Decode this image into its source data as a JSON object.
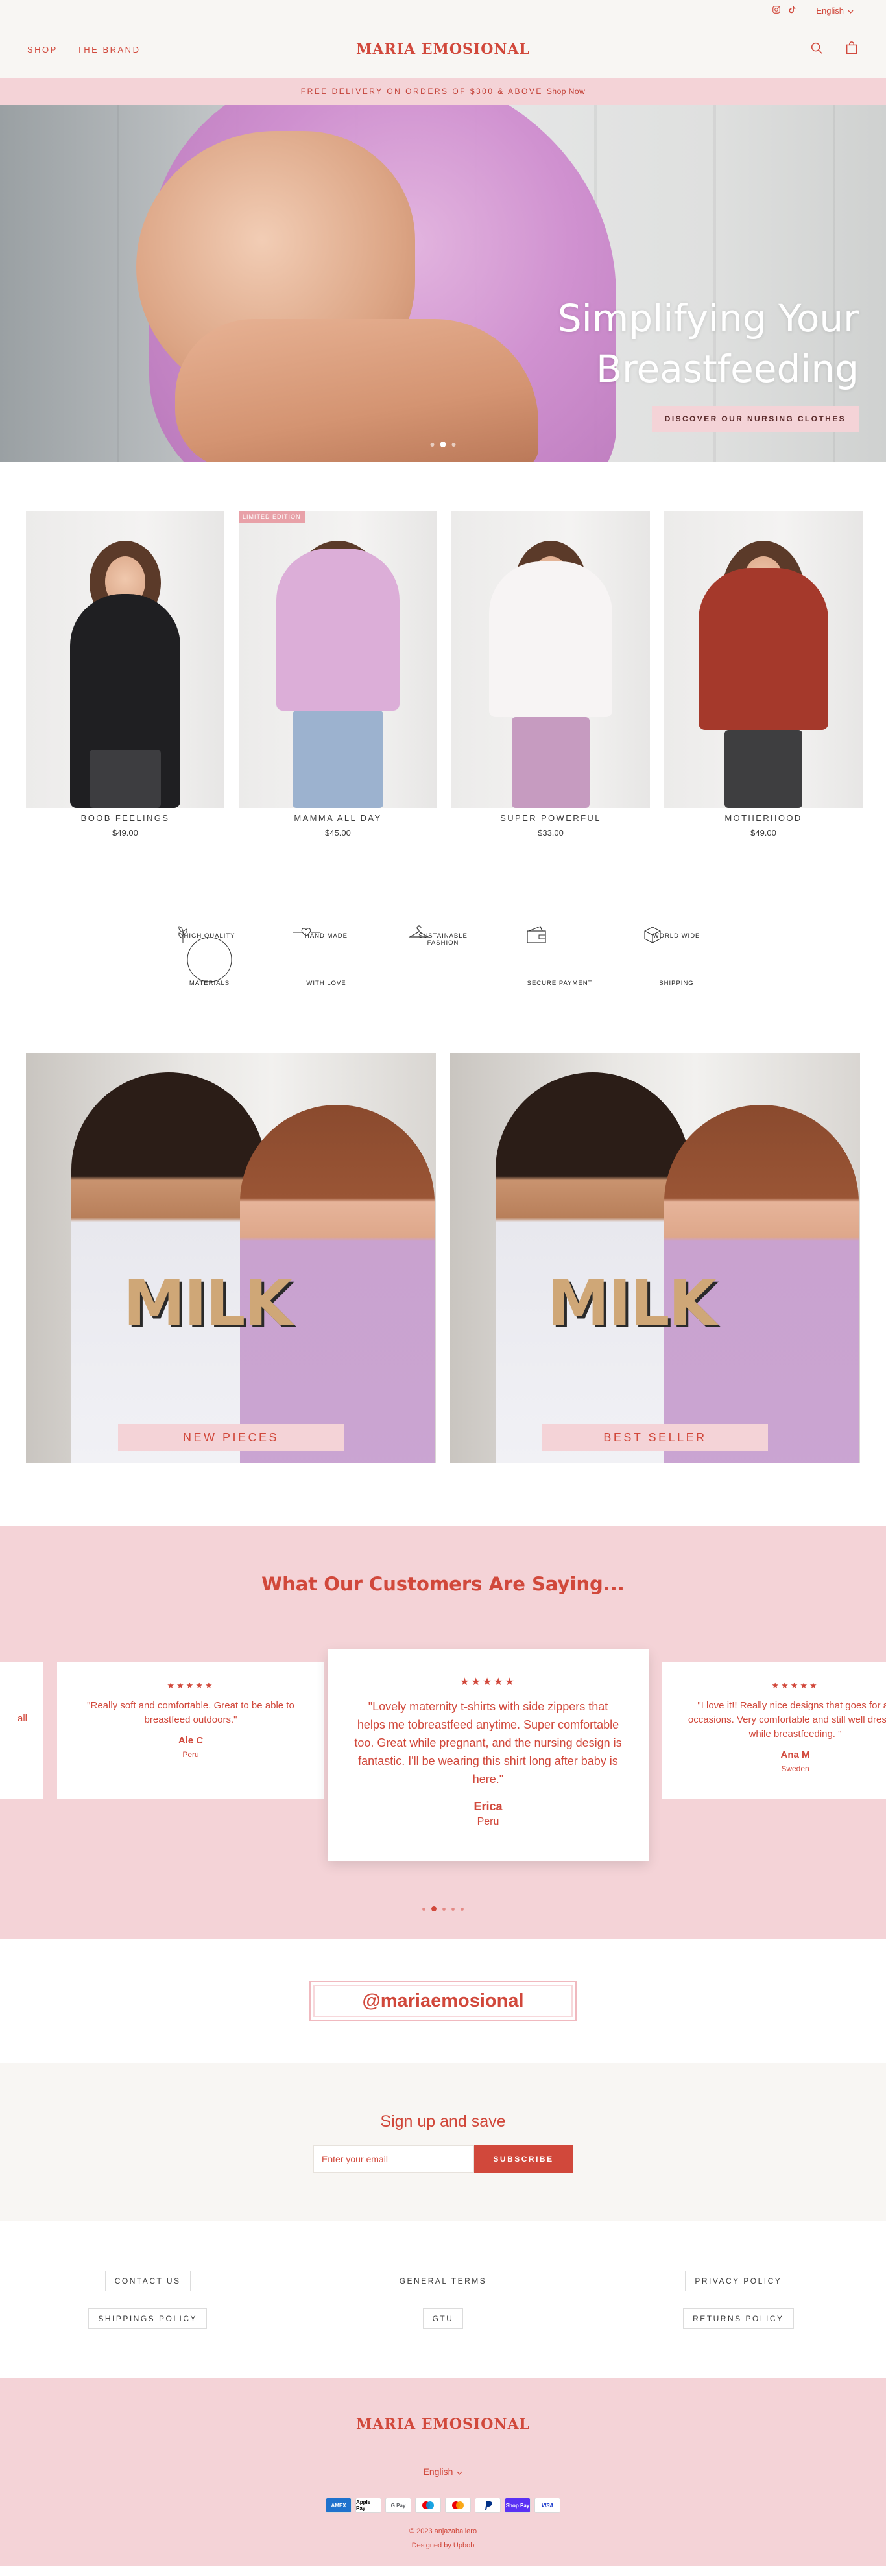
{
  "utility": {
    "language": "English"
  },
  "header": {
    "nav": [
      "SHOP",
      "THE BRAND"
    ],
    "logo": "MARIA EMOSIONAL"
  },
  "announcement": {
    "text": "FREE DELIVERY ON ORDERS OF $300 & ABOVE",
    "link": "Shop Now"
  },
  "hero": {
    "title_line1": "Simplifying Your",
    "title_line2": "Breastfeeding",
    "button": "DISCOVER OUR NURSING CLOTHES"
  },
  "products": [
    {
      "title": "BOOB FEELINGS",
      "price": "$49.00",
      "badge": ""
    },
    {
      "title": "MAMMA ALL DAY",
      "price": "$45.00",
      "badge": "LIMITED EDITION"
    },
    {
      "title": "SUPER POWERFUL",
      "price": "$33.00",
      "badge": ""
    },
    {
      "title": "MOTHERHOOD",
      "price": "$49.00",
      "badge": ""
    }
  ],
  "features": [
    {
      "top": "HIGH QUALITY",
      "bottom": "MATERIALS",
      "icon": "leaf-icon"
    },
    {
      "top": "HAND MADE",
      "bottom": "WITH LOVE",
      "icon": "needle-heart-icon"
    },
    {
      "top": "SUSTAINABLE FASHION",
      "bottom": "",
      "icon": "hanger-icon"
    },
    {
      "top": "",
      "bottom": "SECURE PAYMENT",
      "icon": "wallet-icon"
    },
    {
      "top": "WORLD WIDE",
      "bottom": "SHIPPING",
      "icon": "box-icon"
    }
  ],
  "collections": [
    {
      "label": "NEW PIECES",
      "shirt_text": "MILK"
    },
    {
      "label": "BEST SELLER",
      "shirt_text": "MILK"
    }
  ],
  "testimonials": {
    "heading": "What Our Customers Are Saying...",
    "stars": "★★★★★",
    "cards": [
      {
        "quote": "\"Really soft and comfortable. Great to be able to breastfeed outdoors.\"",
        "name": "Ale C",
        "location": "Peru"
      },
      {
        "quote": "\"Lovely maternity t-shirts with side zippers that helps me tobreastfeed anytime. Super comfortable too. Great while pregnant, and the nursing design is fantastic. I'll be wearing this shirt long after baby is here.\"",
        "name": "Erica",
        "location": "Peru"
      },
      {
        "quote": "\"I love it!! Really nice designs that goes for all occasions. Very comfortable and still well dressed while breastfeeding. \"",
        "name": "Ana M",
        "location": "Sweden"
      }
    ],
    "partial_left": "all"
  },
  "instagram": {
    "handle": "@mariaemosional"
  },
  "newsletter": {
    "title": "Sign up and save",
    "placeholder": "Enter your email",
    "button": "SUBSCRIBE"
  },
  "footer_links": [
    "CONTACT US",
    "GENERAL TERMS",
    "PRIVACY POLICY",
    "SHIPPINGS POLICY",
    "GTU",
    "RETURNS POLICY"
  ],
  "footer": {
    "logo": "MARIA EMOSIONAL",
    "language": "English",
    "payments": [
      "AMEX",
      "Apple Pay",
      "G Pay",
      "Maestro",
      "Mastercard",
      "PayPal",
      "Shop Pay",
      "VISA"
    ],
    "copyright": "© 2023 anjazaballero",
    "designed": "Designed by Upbob"
  },
  "colors": {
    "accent": "#d1483b",
    "pink": "#f4d3d7",
    "cream": "#f8f6f3"
  }
}
